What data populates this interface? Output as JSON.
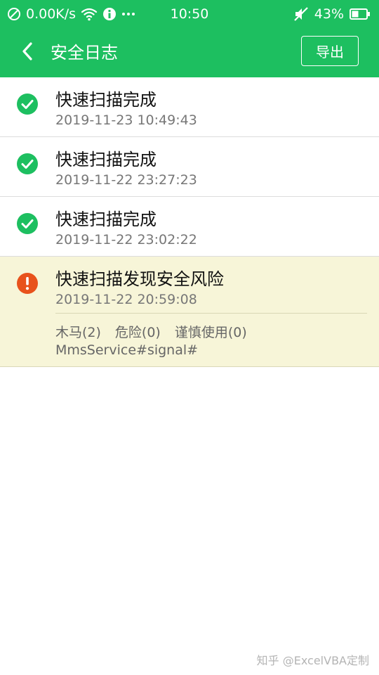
{
  "status_bar": {
    "net_speed": "0.00K/s",
    "time": "10:50",
    "battery": "43%",
    "icons": [
      "no-sim-icon",
      "wifi-icon",
      "usb-debug-icon",
      "more-dots-icon",
      "mute-icon",
      "battery-icon"
    ]
  },
  "header": {
    "back_icon": "chevron-left-icon",
    "title": "安全日志",
    "export_label": "导出"
  },
  "logs": [
    {
      "status": "ok",
      "icon": "check-circle-icon",
      "title": "快速扫描完成",
      "time": "2019-11-23  10:49:43"
    },
    {
      "status": "ok",
      "icon": "check-circle-icon",
      "title": "快速扫描完成",
      "time": "2019-11-22  23:27:23"
    },
    {
      "status": "ok",
      "icon": "check-circle-icon",
      "title": "快速扫描完成",
      "time": "2019-11-22  23:02:22"
    },
    {
      "status": "risk",
      "icon": "warning-circle-icon",
      "title": "快速扫描发现安全风险",
      "time": "2019-11-22  20:59:08",
      "counts": [
        "木马(2)",
        "危险(0)",
        "谨慎使用(0)"
      ],
      "detail": "MmsService#signal#"
    }
  ],
  "watermark": "知乎 @ExcelVBA定制",
  "colors": {
    "brand_green": "#1dbf60",
    "ok_green": "#1dbf60",
    "risk_orange": "#e8521c",
    "risk_background": "#f7f5d8"
  }
}
